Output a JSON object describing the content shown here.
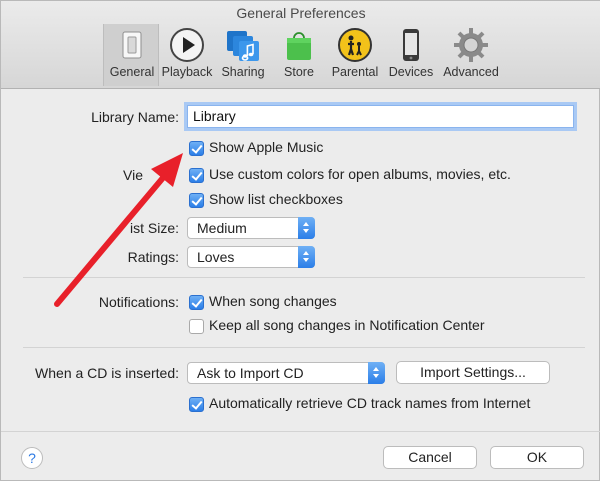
{
  "window": {
    "title": "General Preferences"
  },
  "toolbar": {
    "tabs": [
      {
        "label": "General",
        "icon": "general-switch-icon"
      },
      {
        "label": "Playback",
        "icon": "playback-icon"
      },
      {
        "label": "Sharing",
        "icon": "sharing-icon"
      },
      {
        "label": "Store",
        "icon": "store-bag-icon"
      },
      {
        "label": "Parental",
        "icon": "parental-icon"
      },
      {
        "label": "Devices",
        "icon": "devices-iphone-icon"
      },
      {
        "label": "Advanced",
        "icon": "advanced-gear-icon"
      }
    ],
    "selected": "General"
  },
  "library": {
    "label": "Library Name:",
    "value": "Library"
  },
  "options": {
    "show_apple_music": "Show Apple Music",
    "views_label_partial": "Vie",
    "custom_colors": "Use custom colors for open albums, movies, etc.",
    "list_checkboxes": "Show list checkboxes",
    "list_size_label_partial": "ist Size:",
    "list_size_value": "Medium",
    "ratings_label": "Ratings:",
    "ratings_value": "Loves"
  },
  "notifications": {
    "label": "Notifications:",
    "song_changes": "When song changes",
    "keep_all": "Keep all song changes in Notification Center"
  },
  "cd": {
    "label": "When a CD is inserted:",
    "value": "Ask to Import CD",
    "import_settings": "Import Settings...",
    "auto_retrieve": "Automatically retrieve CD track names from Internet"
  },
  "footer": {
    "help": "?",
    "cancel": "Cancel",
    "ok": "OK"
  },
  "colors": {
    "accent": "#2b7ee8",
    "annotation_arrow": "#e8202a"
  }
}
